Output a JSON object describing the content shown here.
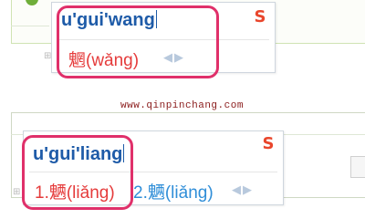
{
  "top_ime": {
    "pinyin": "u'gui'wang",
    "candidates": [
      {
        "index": "",
        "text": "魍(wǎng)"
      }
    ],
    "page_arrows": "◀▶"
  },
  "bottom_ime": {
    "pinyin": "u'gui'liang",
    "candidates": [
      {
        "index": "1.",
        "text": "魉(liǎng)"
      },
      {
        "index": "2.",
        "text": "魉(liǎng)"
      }
    ],
    "page_arrows": "◀▶"
  },
  "logo_glyph": "S",
  "watermark": "www.qinpinchang.com",
  "colors": {
    "highlight": "#e0306a",
    "pinyin": "#1e5ba8",
    "first_candidate": "#e53b3b",
    "other_candidate": "#2f8ed8",
    "logo": "#e9462c"
  }
}
